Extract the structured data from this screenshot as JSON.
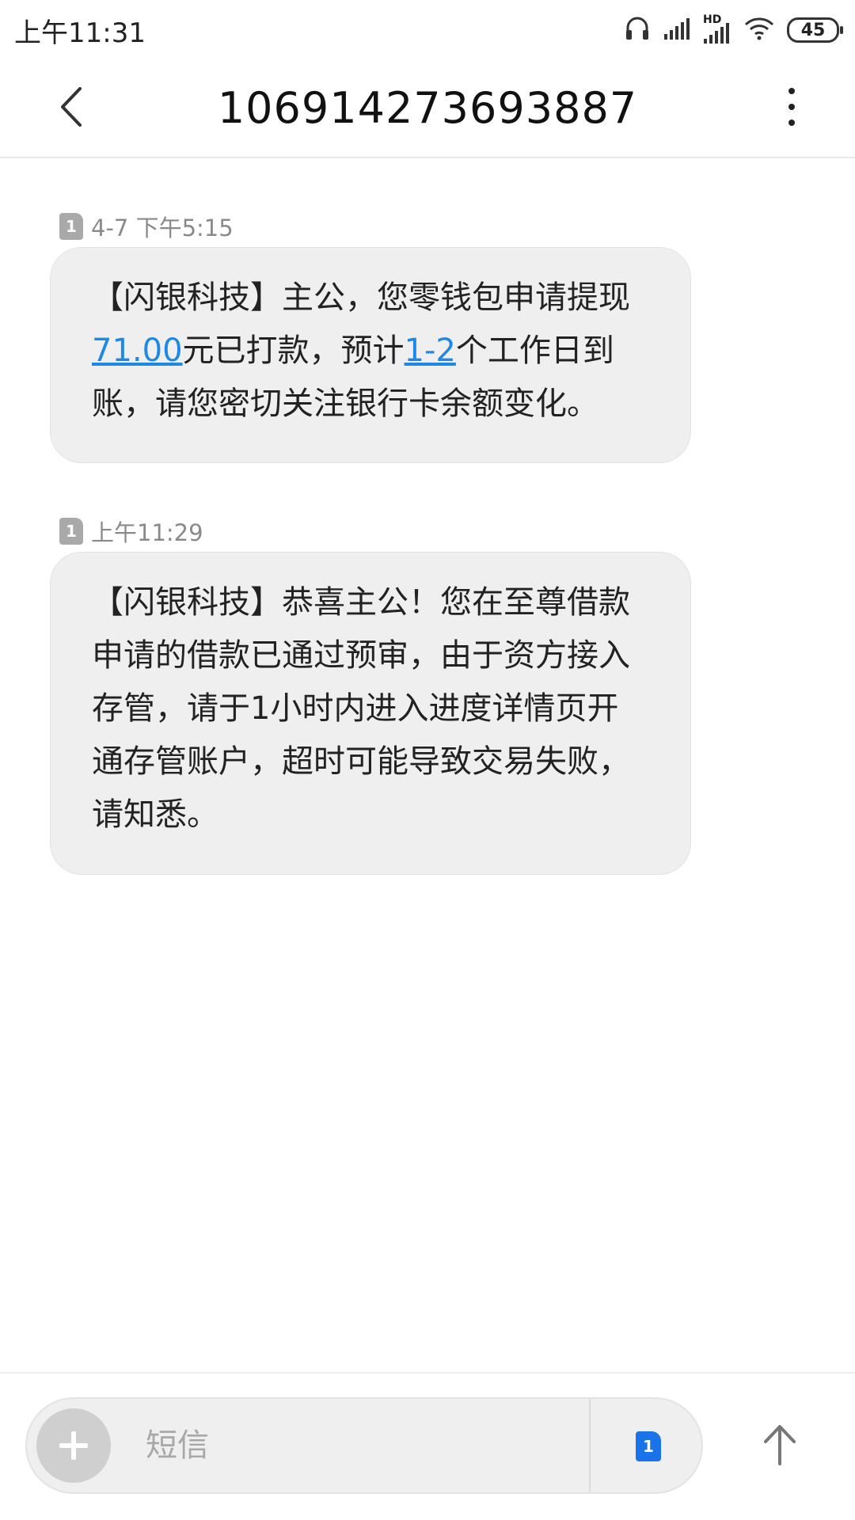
{
  "status_bar": {
    "time": "上午11:31",
    "battery": "45",
    "network_label": "HD"
  },
  "header": {
    "title": "106914273693887"
  },
  "messages": [
    {
      "date": "4-7 下午5:15",
      "sim": "1",
      "parts": [
        "【闪银科技】主公，您零钱包申请提现",
        "71.00",
        "元已打款，预计",
        "1-2",
        "个工作日到账，请您密切关注银行卡余额变化。"
      ]
    },
    {
      "date": "上午11:29",
      "sim": "1",
      "text": "【闪银科技】恭喜主公！您在至尊借款申请的借款已通过预审，由于资方接入存管，请于1小时内进入进度详情页开通存管账户，超时可能导致交易失败，请知悉。"
    }
  ],
  "composer": {
    "placeholder": "短信",
    "sim": "1"
  },
  "icons": {
    "back": "chevron-left-icon",
    "menu": "more-vertical-icon",
    "add": "plus-icon",
    "send": "arrow-up-icon",
    "headphone": "headphone-icon",
    "signal": "signal-icon",
    "wifi": "wifi-icon",
    "battery": "battery-icon"
  }
}
